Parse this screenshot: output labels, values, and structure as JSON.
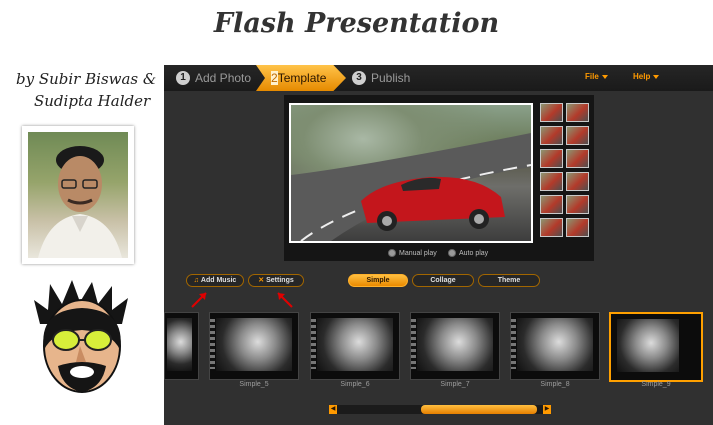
{
  "title": "Flash Presentation",
  "authors": {
    "line1": "by Subir Biswas  &",
    "line2": "Sudipta Halder"
  },
  "app": {
    "steps": [
      {
        "num": "1",
        "label": "Add Photo",
        "active": false
      },
      {
        "num": "2",
        "label": "Template",
        "active": true
      },
      {
        "num": "3",
        "label": "Publish",
        "active": false
      }
    ],
    "menu": {
      "file": "File",
      "help": "Help"
    },
    "playback": {
      "manual": "Manual play",
      "auto": "Auto play"
    },
    "tools": {
      "add_music": "Add Music",
      "settings": "Settings"
    },
    "categories": {
      "simple": "Simple",
      "collage": "Collage",
      "theme": "Theme"
    },
    "slides": [
      {
        "label": ""
      },
      {
        "label": "Simple_5"
      },
      {
        "label": "Simple_6"
      },
      {
        "label": "Simple_7"
      },
      {
        "label": "Simple_8"
      },
      {
        "label": "Simple_9"
      }
    ],
    "selected_slide": "Simple_9",
    "accent": "#ff9a00",
    "arrow_color": "#e00000"
  }
}
